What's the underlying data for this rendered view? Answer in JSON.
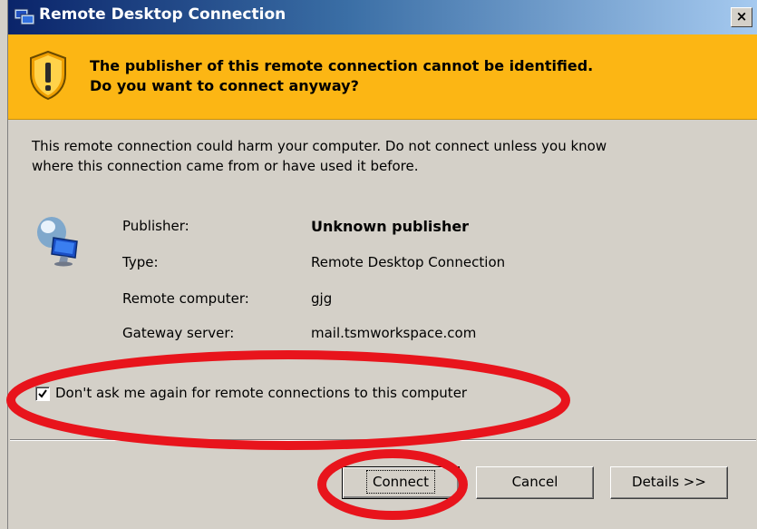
{
  "window": {
    "title": "Remote Desktop Connection",
    "close_label": "×"
  },
  "warning": {
    "line1": "The publisher of this remote connection cannot be identified.",
    "line2": "Do you want to connect anyway?"
  },
  "message": {
    "line1": "This remote connection could harm your computer. Do not connect unless you know",
    "line2": "where this connection came from or have used it before."
  },
  "details": [
    {
      "label": "Publisher:",
      "value": "Unknown publisher"
    },
    {
      "label": "Type:",
      "value": "Remote Desktop Connection"
    },
    {
      "label": "Remote computer:",
      "value": "gjg"
    },
    {
      "label": "Gateway server:",
      "value": "mail.tsmworkspace.com"
    }
  ],
  "checkbox": {
    "label": "Don't ask me again for remote connections to this computer",
    "checked": true
  },
  "buttons": {
    "connect": "Connect",
    "cancel": "Cancel",
    "details": "Details >>"
  },
  "colors": {
    "banner": "#fcb614",
    "annotation": "#e8141c"
  }
}
